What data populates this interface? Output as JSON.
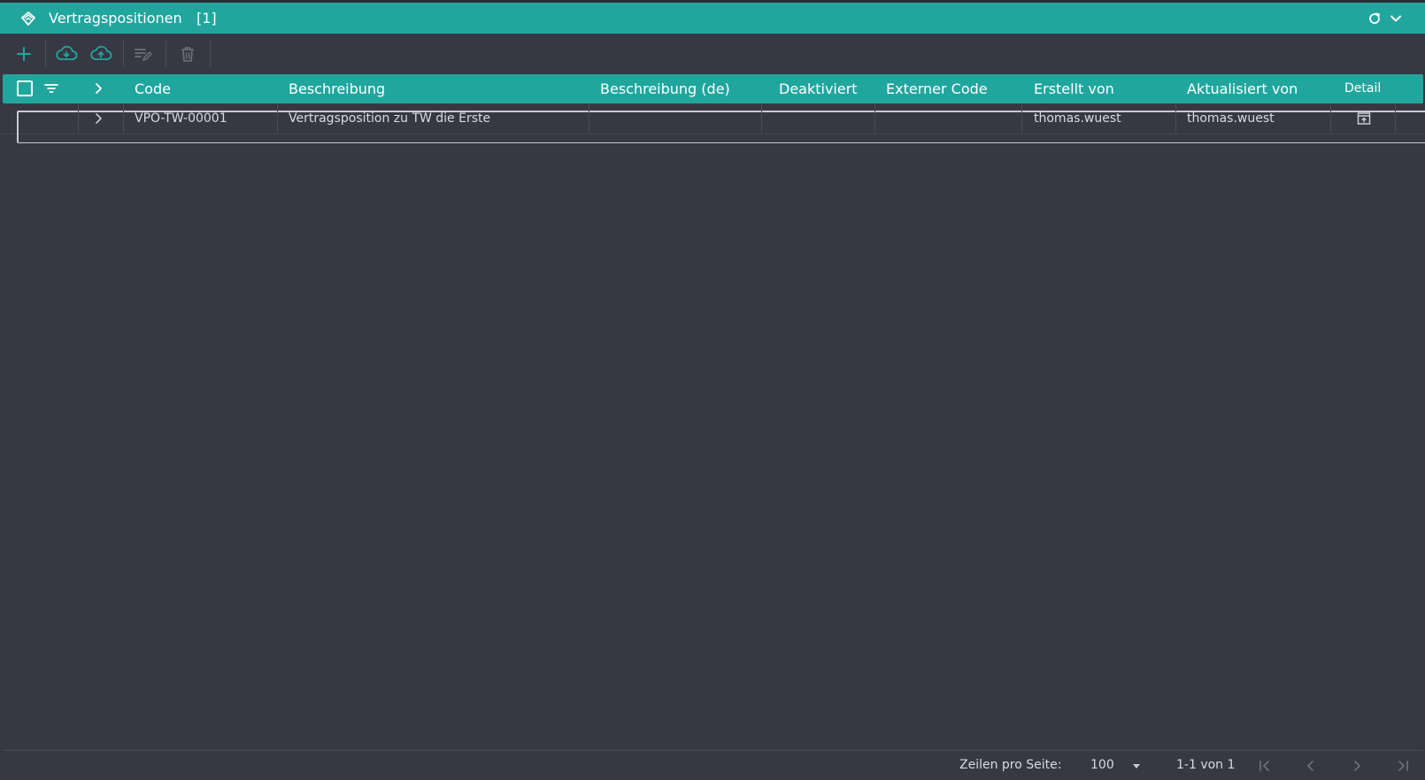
{
  "window": {
    "title": "Vertragspositionen",
    "count": "[1]",
    "icon": "handshake-icon",
    "accent_color": "#21a69e",
    "background_color": "#373843"
  },
  "toolbar": {
    "buttons": [
      {
        "name": "add-button",
        "icon": "plus-icon"
      },
      {
        "name": "import-button",
        "icon": "cloud-download-icon"
      },
      {
        "name": "export-button",
        "icon": "cloud-upload-icon"
      },
      {
        "name": "edit-button",
        "icon": "edit-list-icon"
      },
      {
        "name": "delete-button",
        "icon": "trash-icon"
      }
    ]
  },
  "table": {
    "columns": {
      "code": "Code",
      "beschreibung": "Beschreibung",
      "beschreibung_de": "Beschreibung (de)",
      "deaktiviert": "Deaktiviert",
      "externer_code": "Externer Code",
      "erstellt_von": "Erstellt von",
      "aktualisiert_von": "Aktualisiert von",
      "detail": "Detail"
    },
    "rows": [
      {
        "code": "VPO-TW-00001",
        "beschreibung": "Vertragsposition zu TW die Erste",
        "beschreibung_de": "",
        "deaktiviert": "",
        "externer_code": "",
        "erstellt_von": "thomas.wuest",
        "aktualisiert_von": "thomas.wuest"
      }
    ]
  },
  "pagination": {
    "rows_per_page_label": "Zeilen pro Seite:",
    "rows_per_page_value": "100",
    "range_text": "1-1 von 1"
  }
}
